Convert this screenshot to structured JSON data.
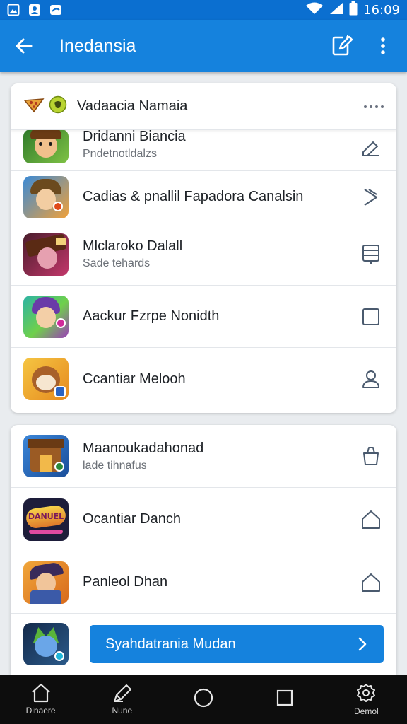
{
  "status_bar": {
    "time": "16:09"
  },
  "app_bar": {
    "title": "Inedansia"
  },
  "card1": {
    "header_title": "Vadaacia Namaia",
    "rows": [
      {
        "title": "Dridanni Biancia",
        "subtitle": "Pndetnotldalzs",
        "action_icon": "pencil-icon"
      },
      {
        "title": "Cadias & pnallil Fapadora Canalsin",
        "subtitle": "",
        "action_icon": "chevron-right-icon"
      },
      {
        "title": "Mlclaroko Dalall",
        "subtitle": "Sade tehards",
        "action_icon": "document-icon"
      },
      {
        "title": "Aackur Fzrpe Nonidth",
        "subtitle": "",
        "action_icon": "checkbox-icon"
      },
      {
        "title": "Ccantiar Melooh",
        "subtitle": "",
        "action_icon": "user-icon"
      }
    ]
  },
  "card2": {
    "rows": [
      {
        "title": "Maanoukadahonad",
        "subtitle": "lade tihnafus",
        "action_icon": "bucket-icon"
      },
      {
        "title": "Ocantiar Danch",
        "subtitle": "",
        "action_icon": "house-icon"
      },
      {
        "title": "Panleol Dhan",
        "subtitle": "",
        "action_icon": "house-icon"
      }
    ],
    "cta_label": "Syahdatrania Mudan",
    "app_icon_text": "DANUEL"
  },
  "nav": {
    "items": [
      {
        "label": "Dinaere",
        "icon": "home-icon"
      },
      {
        "label": "Nune",
        "icon": "pen-icon"
      },
      {
        "label": "",
        "icon": "circle-icon"
      },
      {
        "label": "",
        "icon": "square-icon"
      },
      {
        "label": "Demol",
        "icon": "gear-icon"
      }
    ]
  },
  "colors": {
    "status_bar": "#0b6fd0",
    "app_bar": "#1582dd",
    "accent_button": "#1582dd",
    "background": "#e9ecef",
    "nav_bar": "#0d0d0d"
  }
}
